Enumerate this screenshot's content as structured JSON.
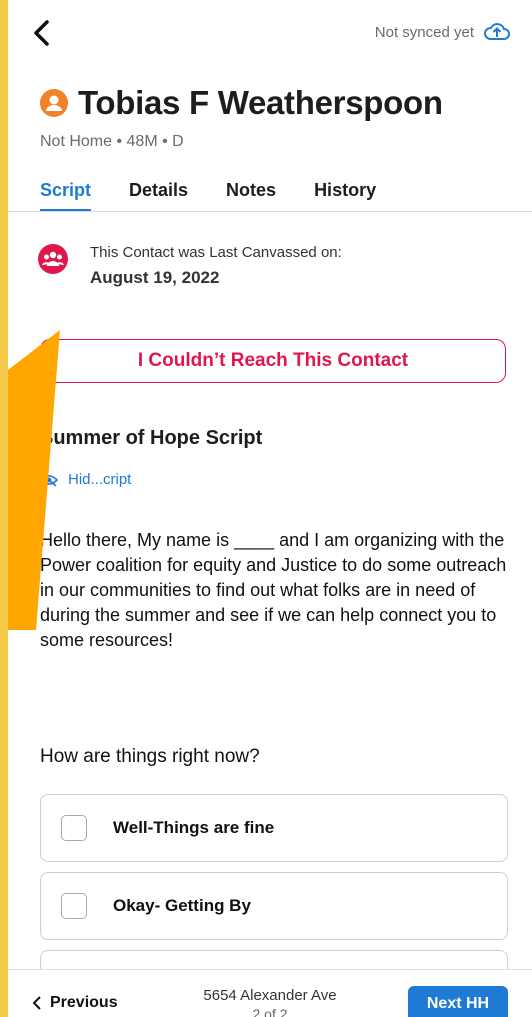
{
  "topbar": {
    "sync_status": "Not synced yet"
  },
  "contact": {
    "name": "Tobias F Weatherspoon",
    "subline": "Not Home • 48M • D"
  },
  "tabs": [
    {
      "label": "Script"
    },
    {
      "label": "Details"
    },
    {
      "label": "Notes"
    },
    {
      "label": "History"
    }
  ],
  "canvass": {
    "label": "This Contact was Last Canvassed on:",
    "date": "August 19, 2022"
  },
  "actions": {
    "unreachable_label": "I Couldn’t Reach This Contact"
  },
  "script": {
    "title": "Summer of Hope Script",
    "hide_label": "Hid...cript",
    "body": "Hello there, My name is ____ and I am organizing with the Power coalition for equity and Justice to do some outreach in our communities to find out what folks are in need of during the summer and see if we can help connect you to some resources!"
  },
  "question": {
    "text": "How are things right now?",
    "options": [
      {
        "label": "Well-Things are fine"
      },
      {
        "label": "Okay- Getting By"
      }
    ]
  },
  "bottom": {
    "previous_label": "Previous",
    "address": "5654 Alexander Ave",
    "count": "2 of 2",
    "next_label": "Next HH"
  },
  "colors": {
    "accent": "#1f7ad6",
    "alert": "#e0174d",
    "avatar": "#f0822a",
    "overlay": "#ffa600"
  }
}
